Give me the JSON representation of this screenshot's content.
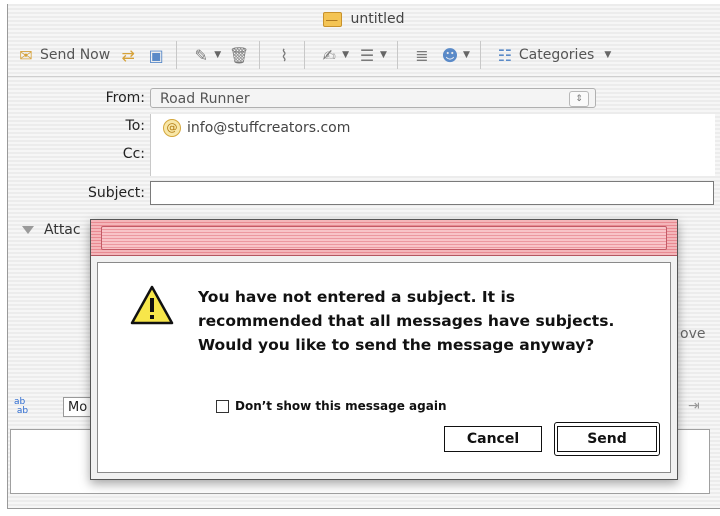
{
  "window": {
    "title": "untitled"
  },
  "toolbar": {
    "send_now_label": "Send Now",
    "categories_label": "Categories",
    "icons": [
      "send-now-icon",
      "send-later-icon",
      "save-icon",
      "attach-icon",
      "delete-icon",
      "paperclip-icon",
      "signature-icon",
      "list-icon",
      "priority-icon",
      "contacts-icon",
      "categories-icon"
    ]
  },
  "header": {
    "from_label": "From:",
    "from_value": "Road Runner",
    "to_label": "To:",
    "to_value": "info@stuffcreators.com",
    "cc_label": "Cc:",
    "subject_label": "Subject:",
    "subject_value": ""
  },
  "attachments": {
    "label": "Attac"
  },
  "background": {
    "remove_partial": "ove"
  },
  "format": {
    "font_select_value": "Mo"
  },
  "dialog": {
    "message": "You have not entered a subject. It is recommended that all messages have subjects. Would you like to send the message anyway?",
    "checkbox_label": "Don’t show this message again",
    "checkbox_checked": false,
    "cancel_label": "Cancel",
    "send_label": "Send",
    "accent_color": "#e88a92"
  }
}
